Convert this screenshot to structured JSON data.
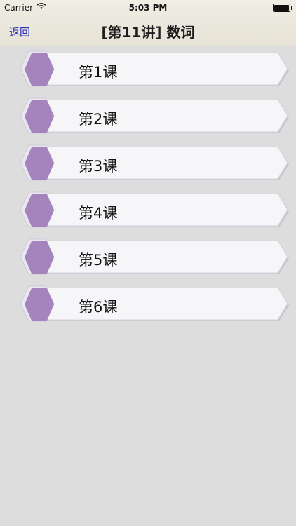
{
  "status": {
    "carrier": "Carrier",
    "time": "5:03 PM"
  },
  "nav": {
    "back_label": "返回",
    "title": "[第11讲] 数词"
  },
  "lessons": [
    {
      "label": "第1课"
    },
    {
      "label": "第2课"
    },
    {
      "label": "第3课"
    },
    {
      "label": "第4课"
    },
    {
      "label": "第5课"
    },
    {
      "label": "第6课"
    }
  ],
  "colors": {
    "hexagon": "#a583bd",
    "background": "#dcdddc"
  }
}
